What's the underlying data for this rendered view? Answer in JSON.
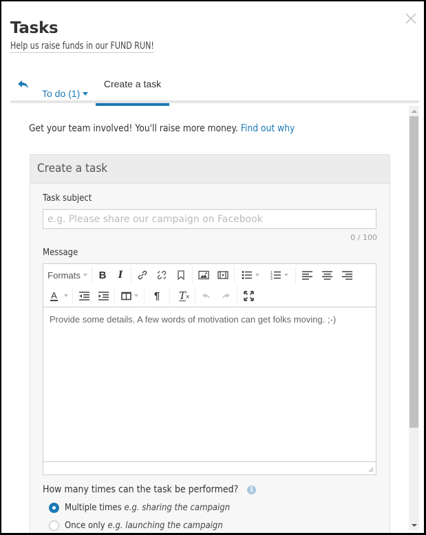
{
  "header": {
    "title": "Tasks",
    "subtitle": "Help us raise funds in our FUND RUN!",
    "close_icon": "close-icon"
  },
  "tabs": {
    "back_icon": "reply-arrow-icon",
    "todo_label": "To do (1)",
    "create_label": "Create a task",
    "active": "Create a task"
  },
  "intro": {
    "text": "Get your team involved! You'll raise more money. ",
    "link": "Find out why"
  },
  "form": {
    "heading": "Create a task",
    "subject_label": "Task subject",
    "subject_value": "",
    "subject_placeholder": "e.g. Please share our campaign on Facebook",
    "subject_counter": "0 / 100",
    "message_label": "Message",
    "toolbar": {
      "formats_label": "Formats",
      "row1": [
        "bold",
        "italic",
        "link",
        "unlink",
        "bookmark",
        "image",
        "media",
        "bullet-list",
        "numbered-list",
        "align-left",
        "align-center",
        "align-right"
      ],
      "row2": [
        "text-color",
        "outdent",
        "indent",
        "table",
        "paragraph-mark",
        "clear-formatting",
        "undo",
        "redo",
        "fullscreen"
      ]
    },
    "message_placeholder": "Provide some details. A few words of motivation can get folks moving. ;-)",
    "frequency_label": "How many times can the task be performed?",
    "frequency_options": [
      {
        "label": "Multiple times",
        "example": "e.g. sharing the campaign",
        "selected": true
      },
      {
        "label": "Once only",
        "example": "e.g. launching the campaign",
        "selected": false
      }
    ]
  },
  "colors": {
    "accent": "#1a7ab5",
    "panel_bg": "#f7f7f7",
    "panel_head_bg": "#ececec"
  }
}
